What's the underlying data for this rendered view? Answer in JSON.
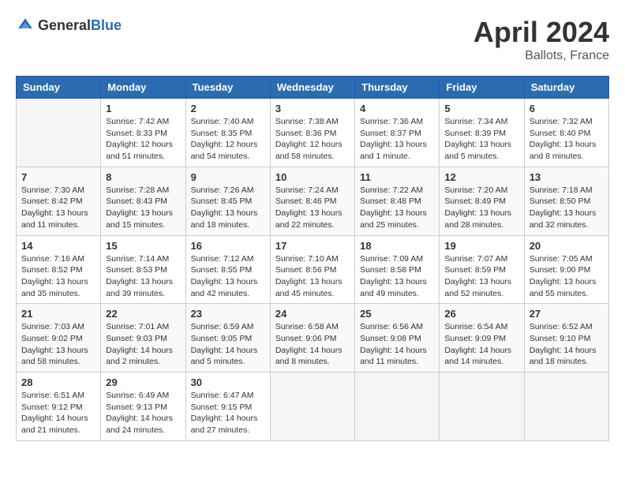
{
  "header": {
    "logo_general": "General",
    "logo_blue": "Blue",
    "month": "April 2024",
    "location": "Ballots, France"
  },
  "weekdays": [
    "Sunday",
    "Monday",
    "Tuesday",
    "Wednesday",
    "Thursday",
    "Friday",
    "Saturday"
  ],
  "weeks": [
    [
      {
        "day": "",
        "sunrise": "",
        "sunset": "",
        "daylight": ""
      },
      {
        "day": "1",
        "sunrise": "Sunrise: 7:42 AM",
        "sunset": "Sunset: 8:33 PM",
        "daylight": "Daylight: 12 hours and 51 minutes."
      },
      {
        "day": "2",
        "sunrise": "Sunrise: 7:40 AM",
        "sunset": "Sunset: 8:35 PM",
        "daylight": "Daylight: 12 hours and 54 minutes."
      },
      {
        "day": "3",
        "sunrise": "Sunrise: 7:38 AM",
        "sunset": "Sunset: 8:36 PM",
        "daylight": "Daylight: 12 hours and 58 minutes."
      },
      {
        "day": "4",
        "sunrise": "Sunrise: 7:36 AM",
        "sunset": "Sunset: 8:37 PM",
        "daylight": "Daylight: 13 hours and 1 minute."
      },
      {
        "day": "5",
        "sunrise": "Sunrise: 7:34 AM",
        "sunset": "Sunset: 8:39 PM",
        "daylight": "Daylight: 13 hours and 5 minutes."
      },
      {
        "day": "6",
        "sunrise": "Sunrise: 7:32 AM",
        "sunset": "Sunset: 8:40 PM",
        "daylight": "Daylight: 13 hours and 8 minutes."
      }
    ],
    [
      {
        "day": "7",
        "sunrise": "Sunrise: 7:30 AM",
        "sunset": "Sunset: 8:42 PM",
        "daylight": "Daylight: 13 hours and 11 minutes."
      },
      {
        "day": "8",
        "sunrise": "Sunrise: 7:28 AM",
        "sunset": "Sunset: 8:43 PM",
        "daylight": "Daylight: 13 hours and 15 minutes."
      },
      {
        "day": "9",
        "sunrise": "Sunrise: 7:26 AM",
        "sunset": "Sunset: 8:45 PM",
        "daylight": "Daylight: 13 hours and 18 minutes."
      },
      {
        "day": "10",
        "sunrise": "Sunrise: 7:24 AM",
        "sunset": "Sunset: 8:46 PM",
        "daylight": "Daylight: 13 hours and 22 minutes."
      },
      {
        "day": "11",
        "sunrise": "Sunrise: 7:22 AM",
        "sunset": "Sunset: 8:48 PM",
        "daylight": "Daylight: 13 hours and 25 minutes."
      },
      {
        "day": "12",
        "sunrise": "Sunrise: 7:20 AM",
        "sunset": "Sunset: 8:49 PM",
        "daylight": "Daylight: 13 hours and 28 minutes."
      },
      {
        "day": "13",
        "sunrise": "Sunrise: 7:18 AM",
        "sunset": "Sunset: 8:50 PM",
        "daylight": "Daylight: 13 hours and 32 minutes."
      }
    ],
    [
      {
        "day": "14",
        "sunrise": "Sunrise: 7:16 AM",
        "sunset": "Sunset: 8:52 PM",
        "daylight": "Daylight: 13 hours and 35 minutes."
      },
      {
        "day": "15",
        "sunrise": "Sunrise: 7:14 AM",
        "sunset": "Sunset: 8:53 PM",
        "daylight": "Daylight: 13 hours and 39 minutes."
      },
      {
        "day": "16",
        "sunrise": "Sunrise: 7:12 AM",
        "sunset": "Sunset: 8:55 PM",
        "daylight": "Daylight: 13 hours and 42 minutes."
      },
      {
        "day": "17",
        "sunrise": "Sunrise: 7:10 AM",
        "sunset": "Sunset: 8:56 PM",
        "daylight": "Daylight: 13 hours and 45 minutes."
      },
      {
        "day": "18",
        "sunrise": "Sunrise: 7:09 AM",
        "sunset": "Sunset: 8:58 PM",
        "daylight": "Daylight: 13 hours and 49 minutes."
      },
      {
        "day": "19",
        "sunrise": "Sunrise: 7:07 AM",
        "sunset": "Sunset: 8:59 PM",
        "daylight": "Daylight: 13 hours and 52 minutes."
      },
      {
        "day": "20",
        "sunrise": "Sunrise: 7:05 AM",
        "sunset": "Sunset: 9:00 PM",
        "daylight": "Daylight: 13 hours and 55 minutes."
      }
    ],
    [
      {
        "day": "21",
        "sunrise": "Sunrise: 7:03 AM",
        "sunset": "Sunset: 9:02 PM",
        "daylight": "Daylight: 13 hours and 58 minutes."
      },
      {
        "day": "22",
        "sunrise": "Sunrise: 7:01 AM",
        "sunset": "Sunset: 9:03 PM",
        "daylight": "Daylight: 14 hours and 2 minutes."
      },
      {
        "day": "23",
        "sunrise": "Sunrise: 6:59 AM",
        "sunset": "Sunset: 9:05 PM",
        "daylight": "Daylight: 14 hours and 5 minutes."
      },
      {
        "day": "24",
        "sunrise": "Sunrise: 6:58 AM",
        "sunset": "Sunset: 9:06 PM",
        "daylight": "Daylight: 14 hours and 8 minutes."
      },
      {
        "day": "25",
        "sunrise": "Sunrise: 6:56 AM",
        "sunset": "Sunset: 9:08 PM",
        "daylight": "Daylight: 14 hours and 11 minutes."
      },
      {
        "day": "26",
        "sunrise": "Sunrise: 6:54 AM",
        "sunset": "Sunset: 9:09 PM",
        "daylight": "Daylight: 14 hours and 14 minutes."
      },
      {
        "day": "27",
        "sunrise": "Sunrise: 6:52 AM",
        "sunset": "Sunset: 9:10 PM",
        "daylight": "Daylight: 14 hours and 18 minutes."
      }
    ],
    [
      {
        "day": "28",
        "sunrise": "Sunrise: 6:51 AM",
        "sunset": "Sunset: 9:12 PM",
        "daylight": "Daylight: 14 hours and 21 minutes."
      },
      {
        "day": "29",
        "sunrise": "Sunrise: 6:49 AM",
        "sunset": "Sunset: 9:13 PM",
        "daylight": "Daylight: 14 hours and 24 minutes."
      },
      {
        "day": "30",
        "sunrise": "Sunrise: 6:47 AM",
        "sunset": "Sunset: 9:15 PM",
        "daylight": "Daylight: 14 hours and 27 minutes."
      },
      {
        "day": "",
        "sunrise": "",
        "sunset": "",
        "daylight": ""
      },
      {
        "day": "",
        "sunrise": "",
        "sunset": "",
        "daylight": ""
      },
      {
        "day": "",
        "sunrise": "",
        "sunset": "",
        "daylight": ""
      },
      {
        "day": "",
        "sunrise": "",
        "sunset": "",
        "daylight": ""
      }
    ]
  ]
}
